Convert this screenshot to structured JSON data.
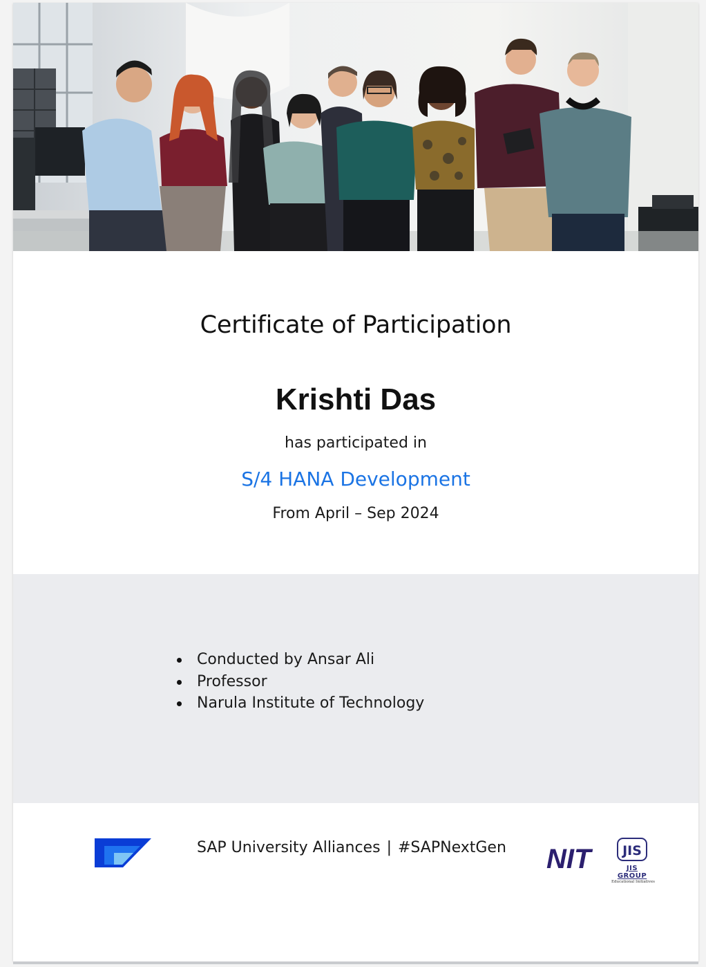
{
  "certificate": {
    "title": "Certificate of Participation",
    "recipient": "Krishti Das",
    "participation_text": "has participated in",
    "course": "S/4 HANA Development",
    "period": "From April – Sep 2024"
  },
  "details": [
    "Conducted by Ansar Ali",
    "Professor",
    "Narula Institute of Technology"
  ],
  "footer": {
    "program": "SAP University Alliances",
    "separator": "|",
    "hashtag": "#SAPNextGen",
    "nit_logo_text": "NIT",
    "jis_logo_text": "JIS",
    "jis_group": "JIS GROUP",
    "jis_subtitle": "Educational Initiatives"
  },
  "colors": {
    "accent_blue": "#1b74e4",
    "grey_band": "#ebecef",
    "sap_blue_dark": "#0a3dd6",
    "nit_purple": "#2b1f6e"
  }
}
